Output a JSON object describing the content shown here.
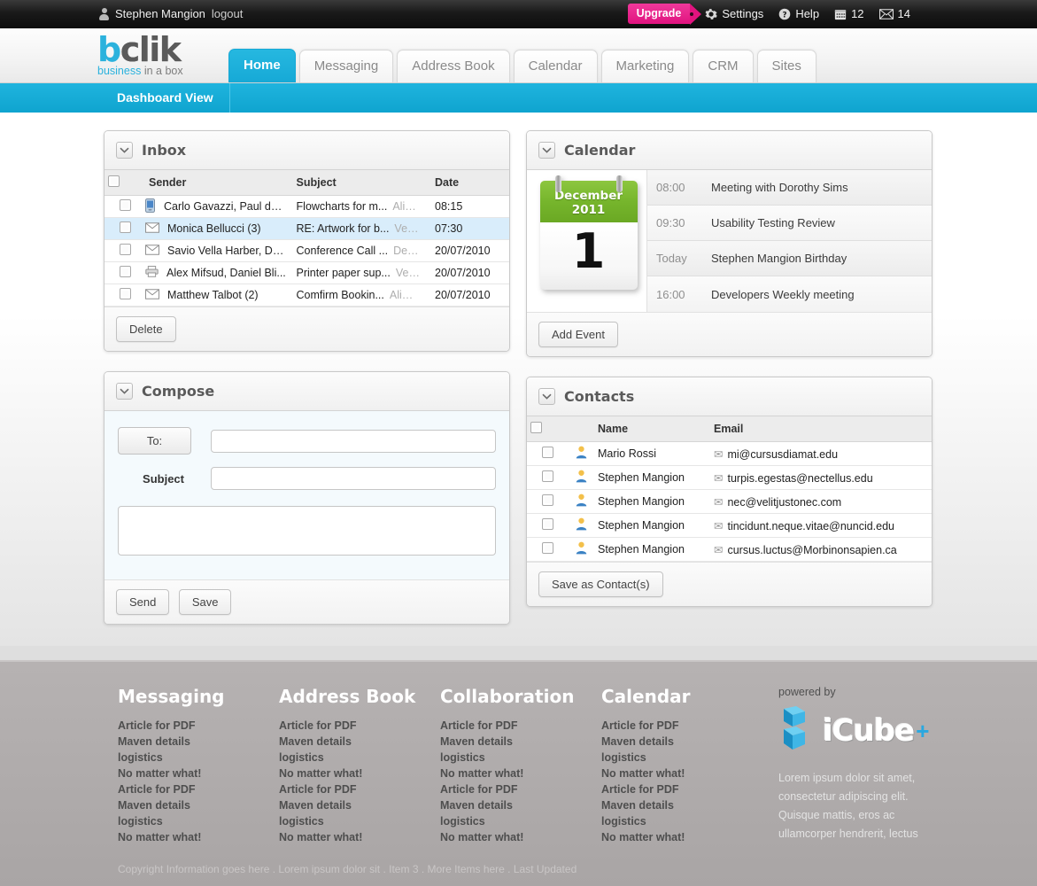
{
  "topbar": {
    "user_name": "Stephen Mangion",
    "logout_label": "logout",
    "upgrade_label": "Upgrade",
    "settings_label": "Settings",
    "help_label": "Help",
    "calendar_count": "12",
    "mail_count": "14"
  },
  "brand": {
    "logo_b": "b",
    "logo_rest": "clik",
    "tagline_blue": "business",
    "tagline_grey": " in a box"
  },
  "nav": {
    "tabs": [
      {
        "label": "Home",
        "active": true
      },
      {
        "label": "Messaging",
        "active": false
      },
      {
        "label": "Address Book",
        "active": false
      },
      {
        "label": "Calendar",
        "active": false
      },
      {
        "label": "Marketing",
        "active": false
      },
      {
        "label": "CRM",
        "active": false
      },
      {
        "label": "Sites",
        "active": false
      }
    ],
    "subnav_item": "Dashboard View"
  },
  "inbox": {
    "title": "Inbox",
    "columns": [
      "Sender",
      "Subject",
      "Date"
    ],
    "rows": [
      {
        "icon": "phone-icon",
        "sender": "Carlo Gavazzi, Paul di ...",
        "subject": "Flowcharts for m...",
        "subject_dim": "Aliq...",
        "date": "08:15",
        "selected": false
      },
      {
        "icon": "envelope-icon",
        "sender": "Monica Bellucci (3)",
        "subject": "RE: Artwork for b...",
        "subject_dim": "Ves...",
        "date": "07:30",
        "selected": true
      },
      {
        "icon": "envelope-icon",
        "sender": "Savio Vella Harber, Da...",
        "subject": "Conference Call ...",
        "subject_dim": "Dea...",
        "date": "20/07/2010",
        "selected": false
      },
      {
        "icon": "printer-icon",
        "sender": "Alex Mifsud, Daniel Bli...",
        "subject": "Printer paper sup...",
        "subject_dim": "Ves...",
        "date": "20/07/2010",
        "selected": false
      },
      {
        "icon": "envelope-icon",
        "sender": "Matthew Talbot (2)",
        "subject": "Comfirm Bookin...",
        "subject_dim": "Aliq...",
        "date": "20/07/2010",
        "selected": false
      }
    ],
    "delete_label": "Delete"
  },
  "compose": {
    "title": "Compose",
    "to_label": "To:",
    "to_value": "",
    "subject_label": "Subject",
    "subject_value": "",
    "body_value": "",
    "send_label": "Send",
    "save_label": "Save"
  },
  "calendar": {
    "title": "Calendar",
    "month_year": "December  2011",
    "day": "1",
    "events": [
      {
        "time": "08:00",
        "title": "Meeting with Dorothy Sims"
      },
      {
        "time": "09:30",
        "title": "Usability Testing Review"
      },
      {
        "time": "Today",
        "title": "Stephen Mangion Birthday"
      },
      {
        "time": "16:00",
        "title": "Developers Weekly meeting"
      }
    ],
    "add_event_label": "Add Event"
  },
  "contacts": {
    "title": "Contacts",
    "columns": [
      "Name",
      "Email"
    ],
    "rows": [
      {
        "name": "Mario Rossi",
        "email": "mi@cursusdiamat.edu"
      },
      {
        "name": "Stephen Mangion",
        "email": "turpis.egestas@nectellus.edu"
      },
      {
        "name": "Stephen Mangion",
        "email": "nec@velitjustonec.com"
      },
      {
        "name": "Stephen Mangion",
        "email": "tincidunt.neque.vitae@nuncid.edu"
      },
      {
        "name": "Stephen Mangion",
        "email": "cursus.luctus@Morbinonsapien.ca"
      }
    ],
    "save_label": "Save as Contact(s)"
  },
  "footer": {
    "columns": [
      {
        "heading": "Messaging",
        "links": [
          "Article for PDF",
          "Maven details",
          "logistics",
          "No matter what!",
          "Article for PDF",
          "Maven details",
          "logistics",
          "No matter what!"
        ]
      },
      {
        "heading": "Address Book",
        "links": [
          "Article for PDF",
          "Maven details",
          "logistics",
          "No matter what!",
          "Article for PDF",
          "Maven details",
          "logistics",
          "No matter what!"
        ]
      },
      {
        "heading": "Collaboration",
        "links": [
          "Article for PDF",
          "Maven details",
          "logistics",
          "No matter what!",
          "Article for PDF",
          "Maven details",
          "logistics",
          "No matter what!"
        ]
      },
      {
        "heading": "Calendar",
        "links": [
          "Article for PDF",
          "Maven details",
          "logistics",
          "No matter what!",
          "Article for PDF",
          "Maven details",
          "logistics",
          "No matter what!"
        ]
      }
    ],
    "powered_by": "powered by",
    "icube_text": "iCube",
    "icube_plus": "+",
    "lorem": [
      "Lorem ipsum dolor sit amet,",
      "consectetur adipiscing elit.",
      "Quisque mattis, eros ac",
      "ullamcorper hendrerit, lectus"
    ],
    "copyright": "Copyright Information goes here . Lorem ipsum dolor sit . Item 3 . More Items here . Last Updated"
  },
  "colors": {
    "accent_blue": "#16a9d6",
    "pink": "#e1137f",
    "green": "#76b52c",
    "selected_row": "#d9edfb",
    "footer_bg": "#b6b2b2"
  }
}
